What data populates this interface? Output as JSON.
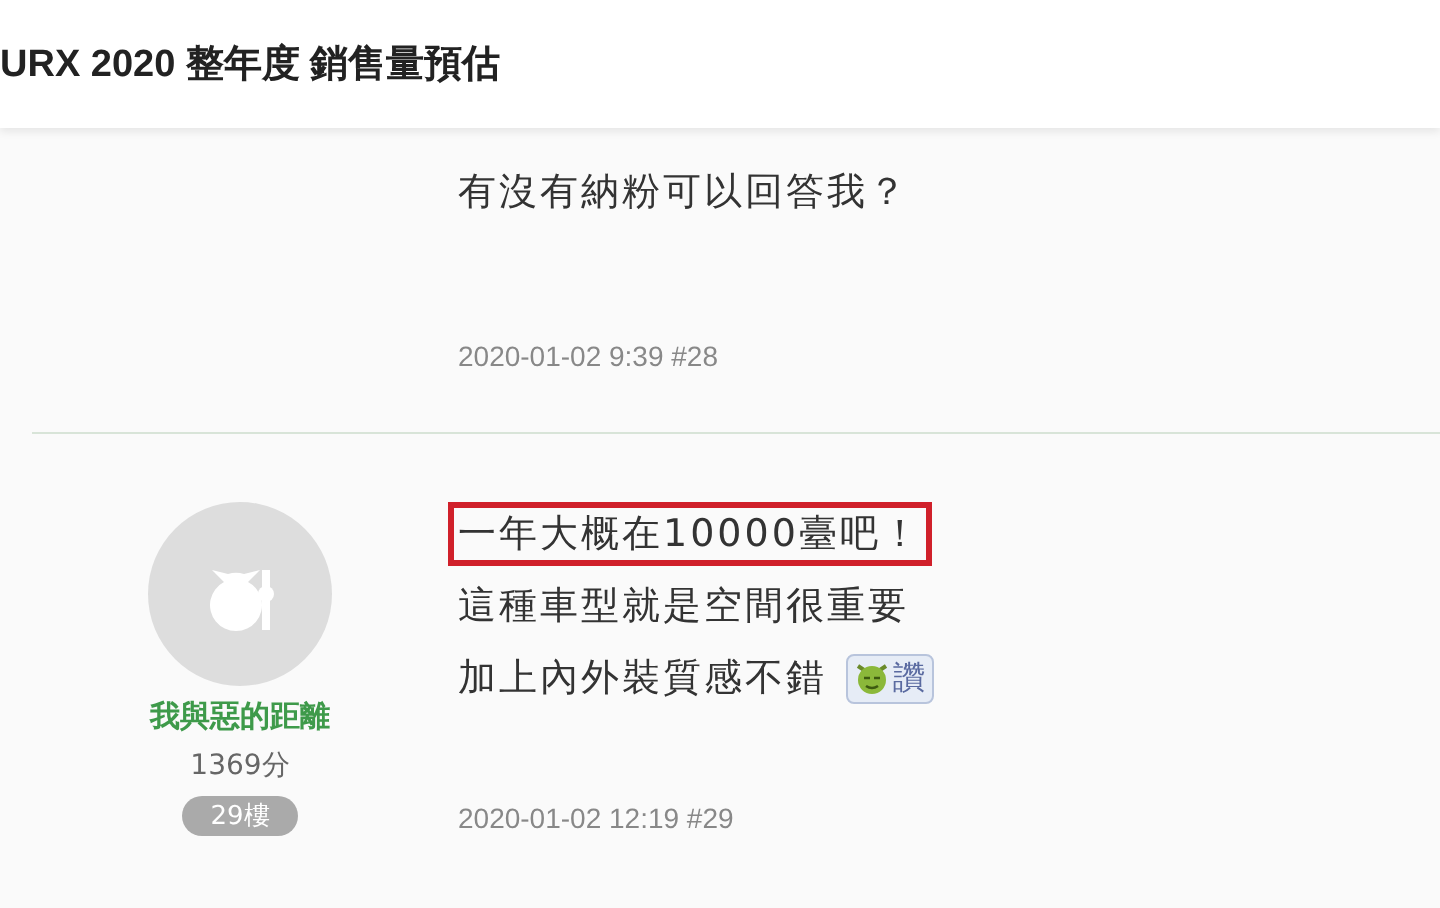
{
  "header": {
    "title": "URX 2020 整年度 銷售量預估"
  },
  "posts": [
    {
      "lines": [
        {
          "text": "有沒有納粉可以回答我？",
          "highlighted": false
        }
      ],
      "timestamp": "2020-01-02 9:39 #28"
    },
    {
      "author": {
        "name": "我與惡的距離",
        "points": "1369分",
        "floor": "29樓"
      },
      "lines": [
        {
          "text": "一年大概在10000臺吧！",
          "highlighted": true
        },
        {
          "text": "這種車型就是空間很重要",
          "highlighted": false
        },
        {
          "text": "加上內外裝質感不錯",
          "highlighted": false,
          "sticker": "讚"
        }
      ],
      "timestamp": "2020-01-02 12:19 #29"
    }
  ]
}
